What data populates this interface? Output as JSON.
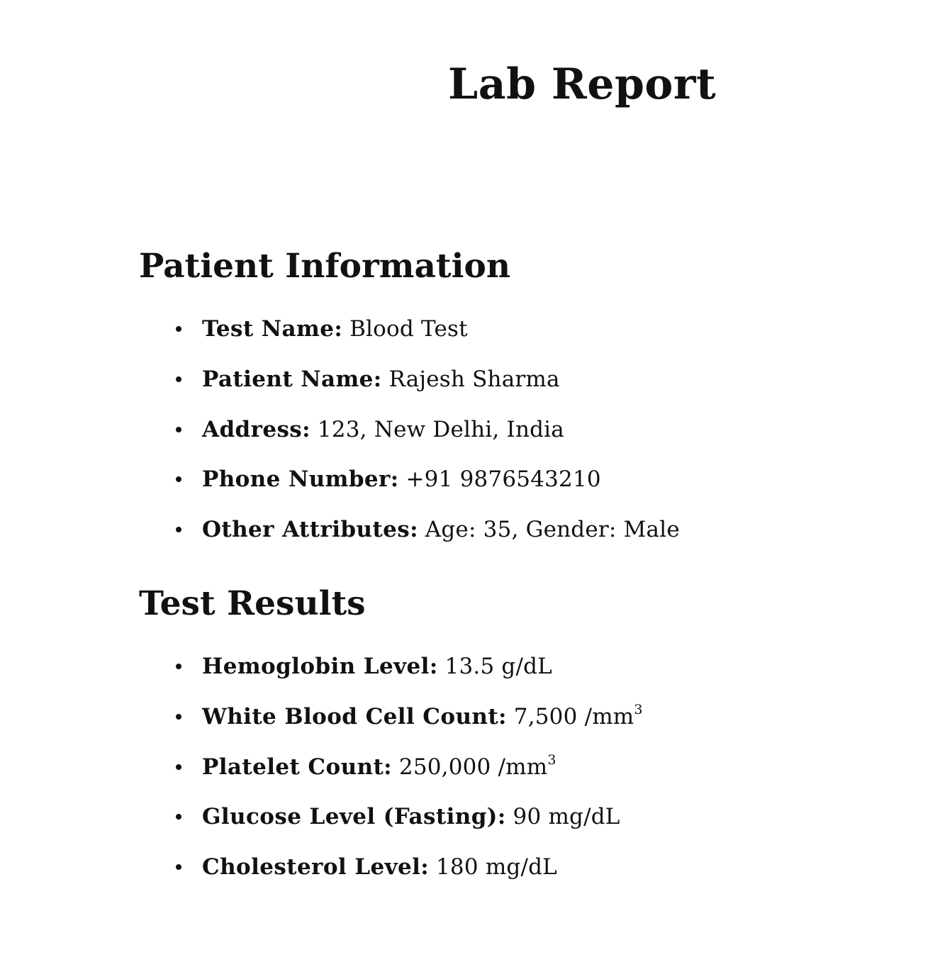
{
  "document": {
    "title": "Lab Report"
  },
  "patient_information": {
    "heading": "Patient Information",
    "items": [
      {
        "label": "Test Name:",
        "value": "Blood Test"
      },
      {
        "label": "Patient Name:",
        "value": "Rajesh Sharma"
      },
      {
        "label": "Address:",
        "value": "123, New Delhi, India"
      },
      {
        "label": "Phone Number:",
        "value": "+91 9876543210"
      },
      {
        "label": "Other Attributes:",
        "value": "Age: 35, Gender: Male"
      }
    ]
  },
  "test_results": {
    "heading": "Test Results",
    "items": [
      {
        "label": "Hemoglobin Level:",
        "value": "13.5 g/dL"
      },
      {
        "label": "White Blood Cell Count:",
        "value": "7,500 /mm",
        "superscript": "3"
      },
      {
        "label": "Platelet Count:",
        "value": "250,000 /mm",
        "superscript": "3"
      },
      {
        "label": "Glucose Level (Fasting):",
        "value": "90 mg/dL"
      },
      {
        "label": "Cholesterol Level:",
        "value": "180 mg/dL"
      }
    ]
  }
}
